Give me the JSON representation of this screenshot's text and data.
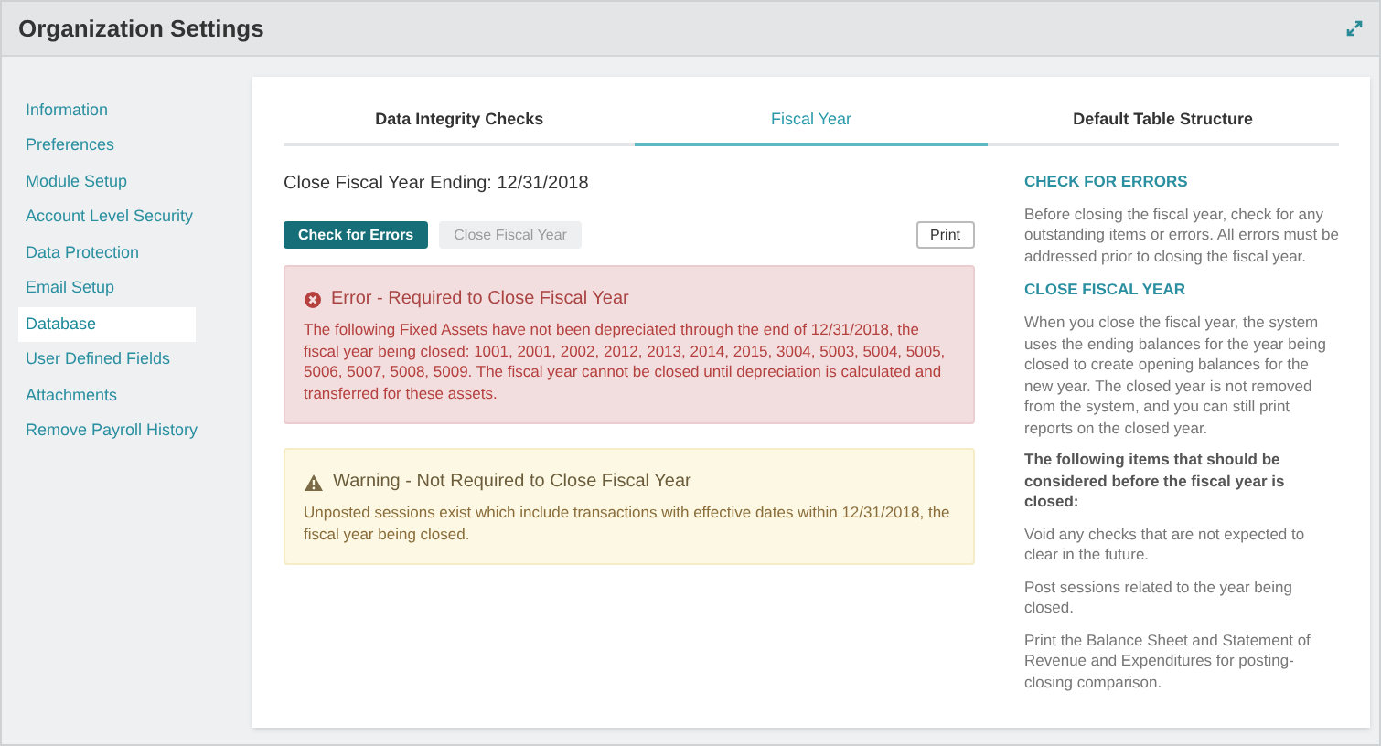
{
  "header": {
    "title": "Organization Settings"
  },
  "sidebar": {
    "items": [
      {
        "label": "Information",
        "selected": false
      },
      {
        "label": "Preferences",
        "selected": false
      },
      {
        "label": "Module Setup",
        "selected": false
      },
      {
        "label": "Account Level Security",
        "selected": false
      },
      {
        "label": "Data Protection",
        "selected": false
      },
      {
        "label": "Email Setup",
        "selected": false
      },
      {
        "label": "Database",
        "selected": true
      },
      {
        "label": "User Defined Fields",
        "selected": false
      },
      {
        "label": "Attachments",
        "selected": false
      },
      {
        "label": "Remove Payroll History",
        "selected": false
      }
    ]
  },
  "tabs": [
    {
      "label": "Data Integrity Checks",
      "selected": false
    },
    {
      "label": "Fiscal Year",
      "selected": true
    },
    {
      "label": "Default Table Structure",
      "selected": false
    }
  ],
  "fiscal_year": {
    "ending": "Close Fiscal Year Ending: 12/31/2018",
    "buttons": [
      {
        "label": "Check for Errors",
        "disabled": false
      },
      {
        "label": "Close Fiscal Year",
        "disabled": true
      }
    ],
    "print": "Print",
    "alerts": [
      {
        "kind": "error",
        "title": "Error - Required to Close Fiscal Year",
        "body": "The following Fixed Assets have not been depreciated through the end of 12/31/2018, the fiscal year being closed: 1001, 2001, 2002, 2012, 2013, 2014, 2015, 3004, 5003, 5004, 5005, 5006, 5007, 5008, 5009. The fiscal year cannot be closed until depreciation is calculated and transferred for these assets."
      },
      {
        "kind": "warning",
        "title": "Warning - Not Required to Close Fiscal Year",
        "body": "Unposted sessions exist which include transactions with effective dates within 12/31/2018, the fiscal year being closed."
      }
    ]
  },
  "help": [
    {
      "kind": "heading",
      "text": "CHECK FOR ERRORS"
    },
    {
      "kind": "text",
      "text": "Before closing the fiscal year, check for any outstanding items or errors. All errors must be addressed prior to closing the fiscal year."
    },
    {
      "kind": "heading",
      "text": "CLOSE FISCAL YEAR"
    },
    {
      "kind": "text",
      "text": "When you close the fiscal year, the system uses the ending balances for the year being closed to create opening balances for the new year. The closed year is not removed from the system, and you can still print reports on the closed year."
    },
    {
      "kind": "bold",
      "text": "The following items that should be considered before the fiscal year is closed:"
    },
    {
      "kind": "text",
      "text": "Void any checks that are not expected to clear in the future."
    },
    {
      "kind": "text",
      "text": "Post sessions related to the year being closed."
    },
    {
      "kind": "text",
      "text": "Print the Balance Sheet and Statement of Revenue and Expenditures for posting-closing comparison."
    }
  ]
}
